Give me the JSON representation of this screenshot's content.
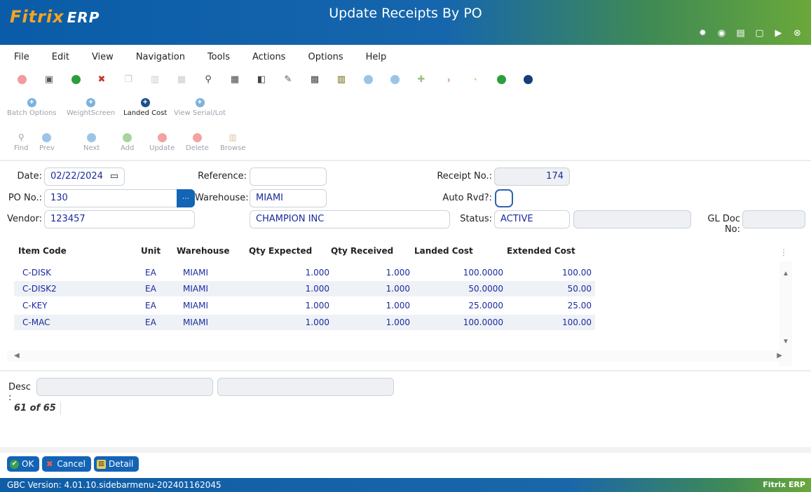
{
  "app": {
    "logo": "Fitrix",
    "logo_suffix": "ERP",
    "title": "Update Receipts By PO"
  },
  "header_icons": [
    "gear-icon",
    "record-icon",
    "document-icon",
    "new-page-icon",
    "play-icon",
    "close-icon"
  ],
  "menu": [
    "File",
    "Edit",
    "View",
    "Navigation",
    "Tools",
    "Actions",
    "Options",
    "Help"
  ],
  "toolbar_labeled_1": [
    {
      "label": "Batch Options",
      "active": false
    },
    {
      "label": "WeightScreen",
      "active": false
    },
    {
      "label": "Landed Cost",
      "active": true
    },
    {
      "label": "View Serial/Lot",
      "active": false
    }
  ],
  "toolbar_labeled_2": [
    {
      "label": "Find"
    },
    {
      "label": "Prev"
    },
    {
      "label": "Next"
    },
    {
      "label": "Add"
    },
    {
      "label": "Update"
    },
    {
      "label": "Delete"
    },
    {
      "label": "Browse"
    }
  ],
  "form": {
    "date_label": "Date:",
    "date_value": "02/22/2024",
    "reference_label": "Reference:",
    "reference_value": "",
    "receipt_label": "Receipt No.:",
    "receipt_value": "174",
    "po_label": "PO No.:",
    "po_value": "130",
    "warehouse_label": "Warehouse:",
    "warehouse_value": "MIAMI",
    "auto_label": "Auto Rvd?:",
    "vendor_label": "Vendor:",
    "vendor_value": "123457",
    "vendor_name": "CHAMPION INC",
    "status_label": "Status:",
    "status_value": "ACTIVE",
    "gl_label": "GL Doc No:",
    "gl_value": ""
  },
  "grid": {
    "columns": [
      "Item Code",
      "Unit",
      "Warehouse",
      "Qty Expected",
      "Qty Received",
      "Landed Cost",
      "Extended Cost"
    ],
    "rows": [
      [
        "C-DISK",
        "EA",
        "MIAMI",
        "1.000",
        "1.000",
        "100.0000",
        "100.00"
      ],
      [
        "C-DISK2",
        "EA",
        "MIAMI",
        "1.000",
        "1.000",
        "50.0000",
        "50.00"
      ],
      [
        "C-KEY",
        "EA",
        "MIAMI",
        "1.000",
        "1.000",
        "25.0000",
        "25.00"
      ],
      [
        "C-MAC",
        "EA",
        "MIAMI",
        "1.000",
        "1.000",
        "100.0000",
        "100.00"
      ]
    ]
  },
  "desc_label": "Desc :",
  "counter": "61 of 65",
  "buttons": {
    "ok": "OK",
    "cancel": "Cancel",
    "detail": "Detail"
  },
  "status": {
    "version": "GBC Version: 4.01.10.sidebarmenu-202401162045",
    "brand": "Fitrix ERP"
  }
}
